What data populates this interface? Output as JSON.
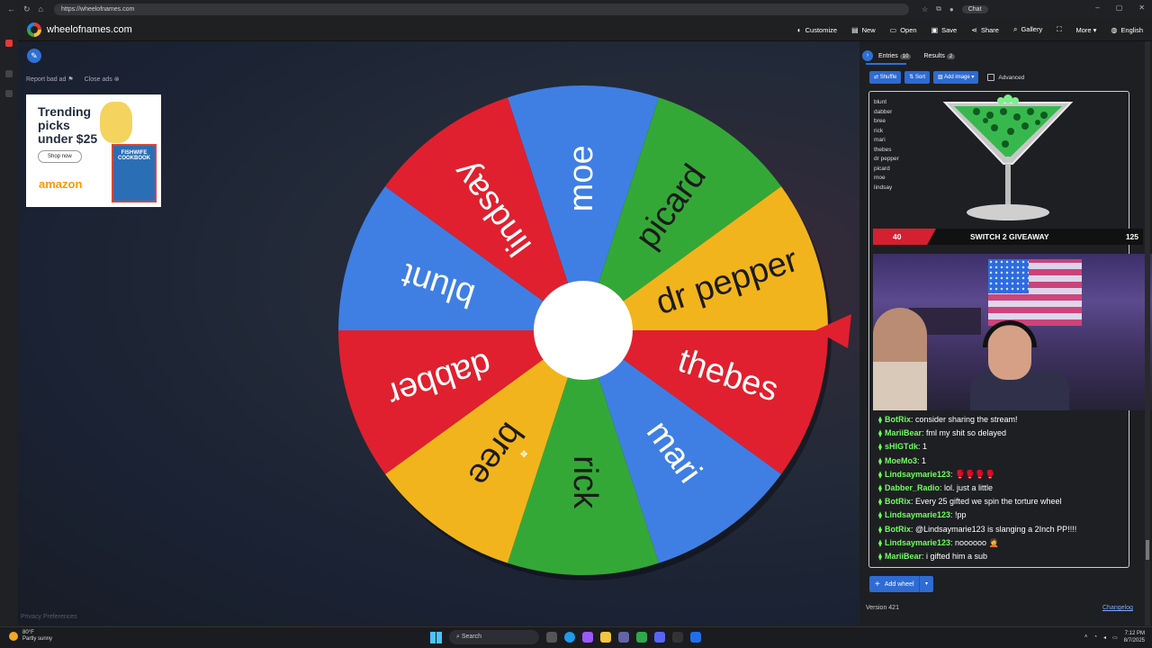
{
  "browser": {
    "url": "https://wheelofnames.com",
    "chat_label": "Chat"
  },
  "header": {
    "site_name": "wheelofnames.com",
    "menu": [
      "Customize",
      "New",
      "Open",
      "Save",
      "Share",
      "Gallery",
      "More",
      "English"
    ]
  },
  "ads": {
    "report_label": "Report bad ad",
    "close_label": "Close ads",
    "headline_1": "Trending",
    "headline_2": "picks",
    "headline_3": "under $25",
    "shop_label": "Shop now",
    "brand": "amazon",
    "book_title": "FISHWIFE COOKBOOK"
  },
  "privacy_label": "Privacy Preferences",
  "wheel": {
    "segments": [
      {
        "label": "moe",
        "color": "#3f7fe3"
      },
      {
        "label": "picard",
        "color": "#34a837"
      },
      {
        "label": "dr pepper",
        "color": "#f2b41c"
      },
      {
        "label": "thebes",
        "color": "#e0202e"
      },
      {
        "label": "mari",
        "color": "#3f7fe3"
      },
      {
        "label": "rick",
        "color": "#34a837"
      },
      {
        "label": "bree",
        "color": "#f2b41c"
      },
      {
        "label": "dabber",
        "color": "#e0202e"
      },
      {
        "label": "blunt",
        "color": "#3f7fe3"
      },
      {
        "label": "lindsay",
        "color": "#e0202e"
      }
    ],
    "pointer_color": "#e0202e"
  },
  "panel": {
    "tab_entries": "Entries",
    "entries_count": "10",
    "tab_results": "Results",
    "results_count": "2",
    "shuffle_label": "Shuffle",
    "sort_label": "Sort",
    "add_image_label": "Add image",
    "advanced_label": "Advanced",
    "entries": [
      "blunt",
      "dabber",
      "bree",
      "rick",
      "mari",
      "thebes",
      " dr pepper",
      "picard",
      "moe",
      "lindsay"
    ],
    "add_wheel_label": "Add wheel",
    "version": "Version 421",
    "changelog": "Changelog"
  },
  "giveaway": {
    "left_number": "40",
    "title": "SWITCH 2 GIVEAWAY",
    "right_number": "125"
  },
  "chat": [
    {
      "user": "BotRix",
      "message": ": consider sharing the stream!"
    },
    {
      "user": "MariiBear",
      "message": ": fml my shit so delayed"
    },
    {
      "user": "sHIGTdk",
      "message": ": 1"
    },
    {
      "user": "MoeMo3",
      "message": ": 1"
    },
    {
      "user": "Lindsaymarie123",
      "message": ": 🥊🥊🥊🥊"
    },
    {
      "user": "Dabber_Radio",
      "message": ": lol. just a little"
    },
    {
      "user": "BotRix",
      "message": ": Every 25 gifted we spin the torture wheel"
    },
    {
      "user": "Lindsaymarie123",
      "message": ": !pp"
    },
    {
      "user": "BotRix",
      "message": ": @Lindsaymarie123 is slanging a 2Inch PP!!!!"
    },
    {
      "user": "Lindsaymarie123",
      "message": ": noooooo 🤦"
    },
    {
      "user": "MariiBear",
      "message": ": i gifted him a sub"
    }
  ],
  "taskbar": {
    "temperature": "80°F",
    "weather": "Partly sunny",
    "search_placeholder": "Search",
    "time": "7:12 PM",
    "date": "8/7/2025"
  }
}
